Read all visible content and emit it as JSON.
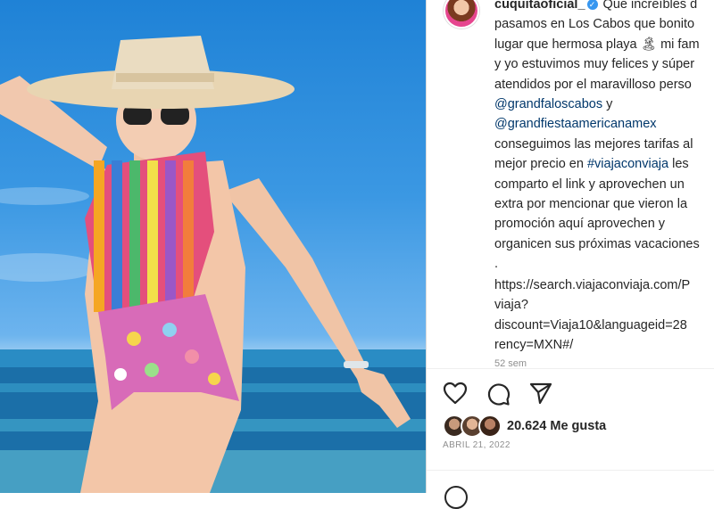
{
  "post": {
    "username": "cuquitaoficial_",
    "caption_start": " Que increíbles d",
    "caption_lines": [
      "pasamos en Los Cabos que bonito",
      "lugar que hermosa playa 🏝 mi fam",
      "y yo estuvimos muy felices y súper",
      "atendidos por el maravilloso perso"
    ],
    "mention1": "@grandfaloscabos",
    "mention1_suffix": " y",
    "mention2": "@grandfiestaamericanamex",
    "caption_lines2a": "conseguimos las mejores tarifas al",
    "caption_lines2b": "mejor precio en ",
    "hashtag": "#viajaconviaja",
    "caption_lines2c": " les",
    "caption_lines3": [
      "comparto el link y aprovechen un",
      "extra por mencionar que vieron la",
      "promoción aquí aprovechen y",
      "organicen sus próximas vacaciones",
      "."
    ],
    "url_lines": [
      "https://search.viajaconviaja.com/P",
      "viaja?",
      "discount=Viaja10&languageid=28",
      "rency=MXN#/"
    ],
    "time_ago": "52 sem",
    "likes": "20.624 Me gusta",
    "date": "ABRIL 21, 2022"
  },
  "icons": {
    "like": "heart-icon",
    "comment": "comment-icon",
    "share": "send-icon"
  },
  "colors": {
    "link": "#00376b",
    "verified": "#3897f0",
    "text": "#262626",
    "muted": "#8e8e8e"
  }
}
